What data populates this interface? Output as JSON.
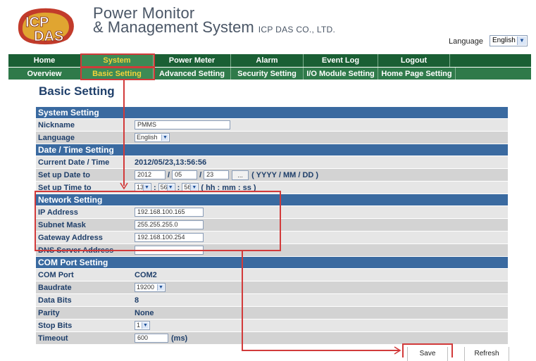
{
  "header": {
    "title_line1": "Power Monitor",
    "title_line2": "& Management System",
    "company": "ICP DAS CO., LTD.",
    "logo_text": "ICP DAS",
    "language_label": "Language",
    "language_value": "English"
  },
  "nav_main": [
    "Home",
    "System",
    "Power Meter",
    "Alarm",
    "Event Log",
    "Logout"
  ],
  "nav_sub": [
    "Overview",
    "Basic Setting",
    "Advanced Setting",
    "Security Setting",
    "I/O Module Setting",
    "Home Page Setting"
  ],
  "page_title": "Basic Setting",
  "system_setting": {
    "header": "System Setting",
    "nickname_label": "Nickname",
    "nickname_value": "PMMS",
    "language_label": "Language",
    "language_value": "English"
  },
  "datetime": {
    "header": "Date / Time Setting",
    "current_label": "Current Date / Time",
    "current_value": "2012/05/23,13:56:56",
    "setdate_label": "Set up Date to",
    "year": "2012",
    "month": "05",
    "day": "23",
    "date_sep": "/",
    "date_button": "...",
    "date_format": "( YYYY / MM / DD )",
    "settime_label": "Set up Time to",
    "hour": "13",
    "minute": "56",
    "second": "56",
    "time_sep": ":",
    "time_format": "( hh : mm : ss )"
  },
  "network": {
    "header": "Network Setting",
    "ip_label": "IP Address",
    "ip_value": "192.168.100.165",
    "mask_label": "Subnet Mask",
    "mask_value": "255.255.255.0",
    "gateway_label": "Gateway Address",
    "gateway_value": "192.168.100.254",
    "dns_label": "DNS Server Address",
    "dns_value": ""
  },
  "com": {
    "header": "COM Port Setting",
    "port_label": "COM Port",
    "port_value": "COM2",
    "baud_label": "Baudrate",
    "baud_value": "19200",
    "databits_label": "Data Bits",
    "databits_value": "8",
    "parity_label": "Parity",
    "parity_value": "None",
    "stopbits_label": "Stop Bits",
    "stopbits_value": "1",
    "timeout_label": "Timeout",
    "timeout_value": "600",
    "timeout_unit": "(ms)"
  },
  "actions": {
    "save": "Save",
    "refresh": "Refresh"
  },
  "colors": {
    "nav_main_bg": "#1a5f34",
    "nav_sub_bg": "#2f7a4a",
    "section_bg": "#3a6aa0",
    "active_nav_text": "#f3d23a",
    "annotation": "#d23a3a"
  }
}
